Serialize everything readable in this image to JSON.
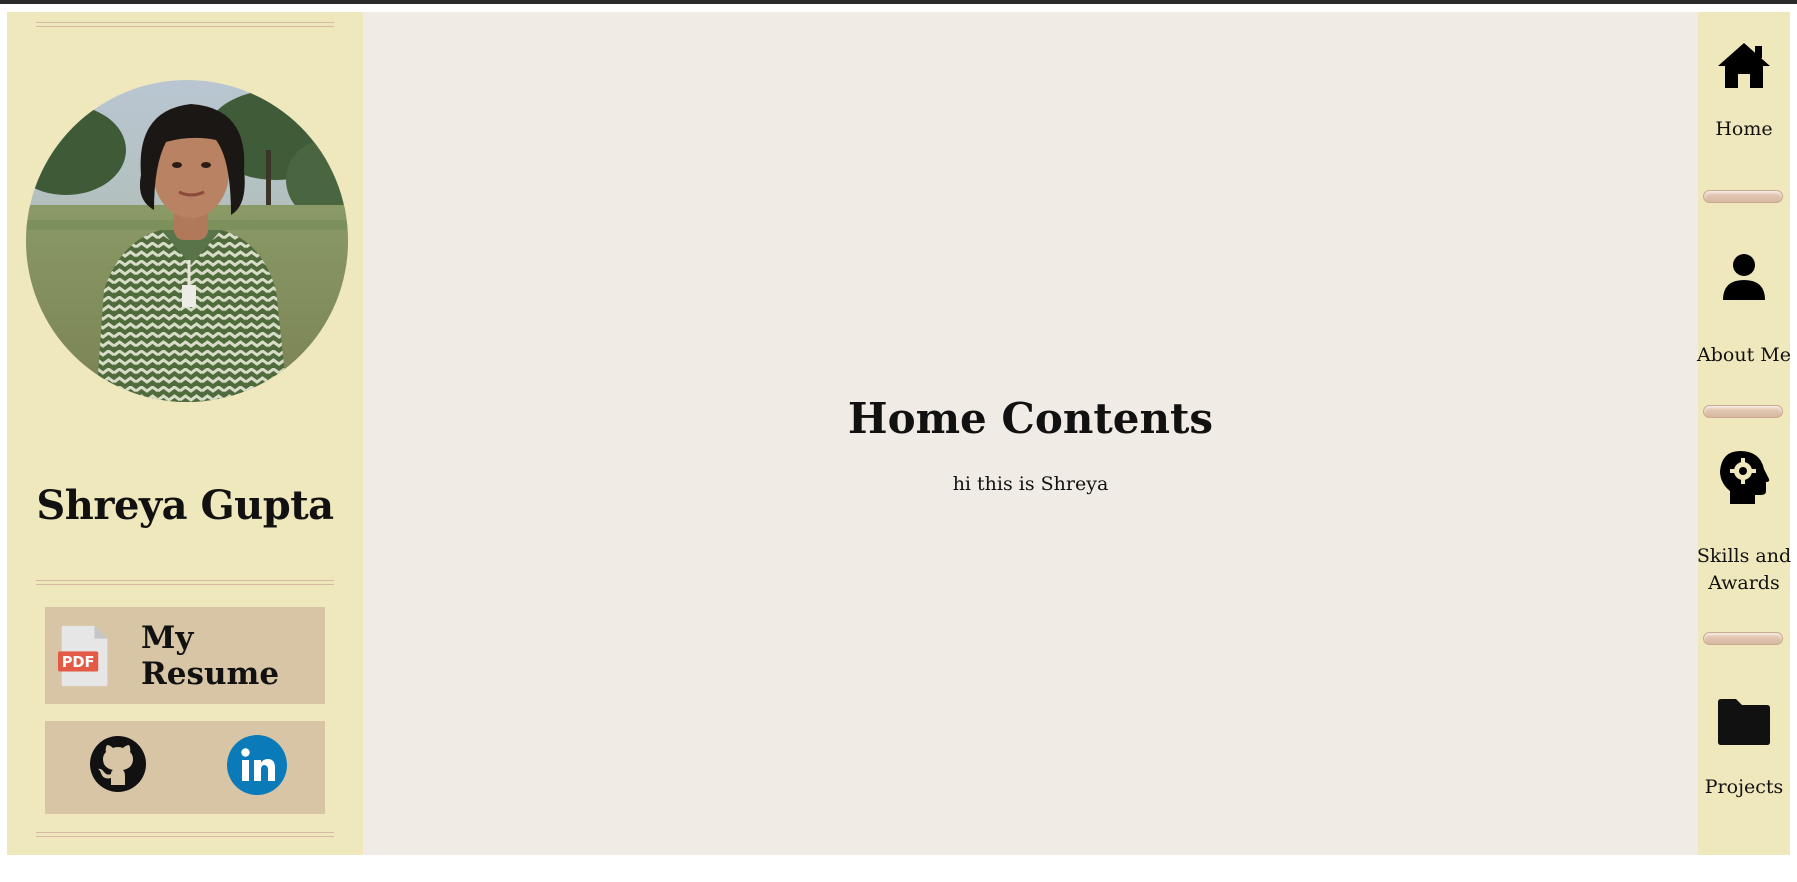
{
  "profile": {
    "name": "Shreya Gupta",
    "photo_alt": "profile photo"
  },
  "links": {
    "resume_label": "My Resume",
    "pdf_badge": "PDF",
    "github_icon": "github-icon",
    "linkedin_icon": "linkedin-icon"
  },
  "main": {
    "title": "Home Contents",
    "text": "hi this is Shreya"
  },
  "nav": {
    "items": [
      {
        "label": "Home",
        "icon": "home-icon"
      },
      {
        "label": "About Me",
        "icon": "user-icon"
      },
      {
        "label": "Skills and",
        "label2": "Awards",
        "icon": "head-gear-icon"
      },
      {
        "label": "Projects",
        "icon": "folder-icon"
      }
    ]
  },
  "colors": {
    "sidebar_bg": "#efe8bd",
    "main_bg": "#f0ebe4",
    "card_bg": "#d7c5a6",
    "divider": "#d8b7a4",
    "linkedin_blue": "#0a7ab8",
    "pdf_red": "#e35b45"
  }
}
